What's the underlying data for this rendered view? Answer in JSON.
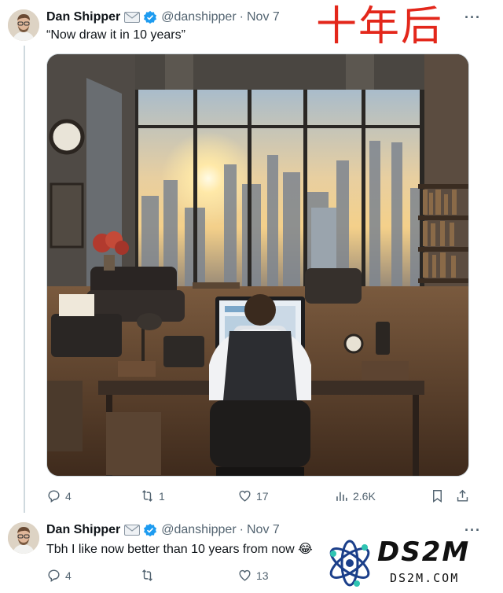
{
  "overlay_caption": "十年后",
  "tweets": [
    {
      "author_name": "Dan Shipper",
      "handle": "@danshipper",
      "date": "Nov 7",
      "text": "“Now draw it in 10 years”",
      "stats": {
        "replies": "4",
        "reposts": "1",
        "likes": "17",
        "views": "2.6K"
      }
    },
    {
      "author_name": "Dan Shipper",
      "handle": "@danshipper",
      "date": "Nov 7",
      "text": "Tbh I like now better than 10 years from now 😂",
      "stats": {
        "replies": "4",
        "reposts": "",
        "likes": "13"
      }
    }
  ],
  "separator": "·",
  "watermark": {
    "brand": "DS2M",
    "url": "DS2M.COM"
  },
  "icons": {
    "mail": "mail-icon",
    "verified": "verified-badge-icon",
    "more": "more-options-icon",
    "reply": "reply-icon",
    "repost": "repost-icon",
    "like": "heart-icon",
    "views": "analytics-icon",
    "bookmark": "bookmark-icon",
    "share": "share-icon"
  },
  "colors": {
    "verified": "#1d9bf0",
    "overlay_caption": "#e3271b",
    "muted": "#536471",
    "thread_line": "#cfd9de"
  }
}
